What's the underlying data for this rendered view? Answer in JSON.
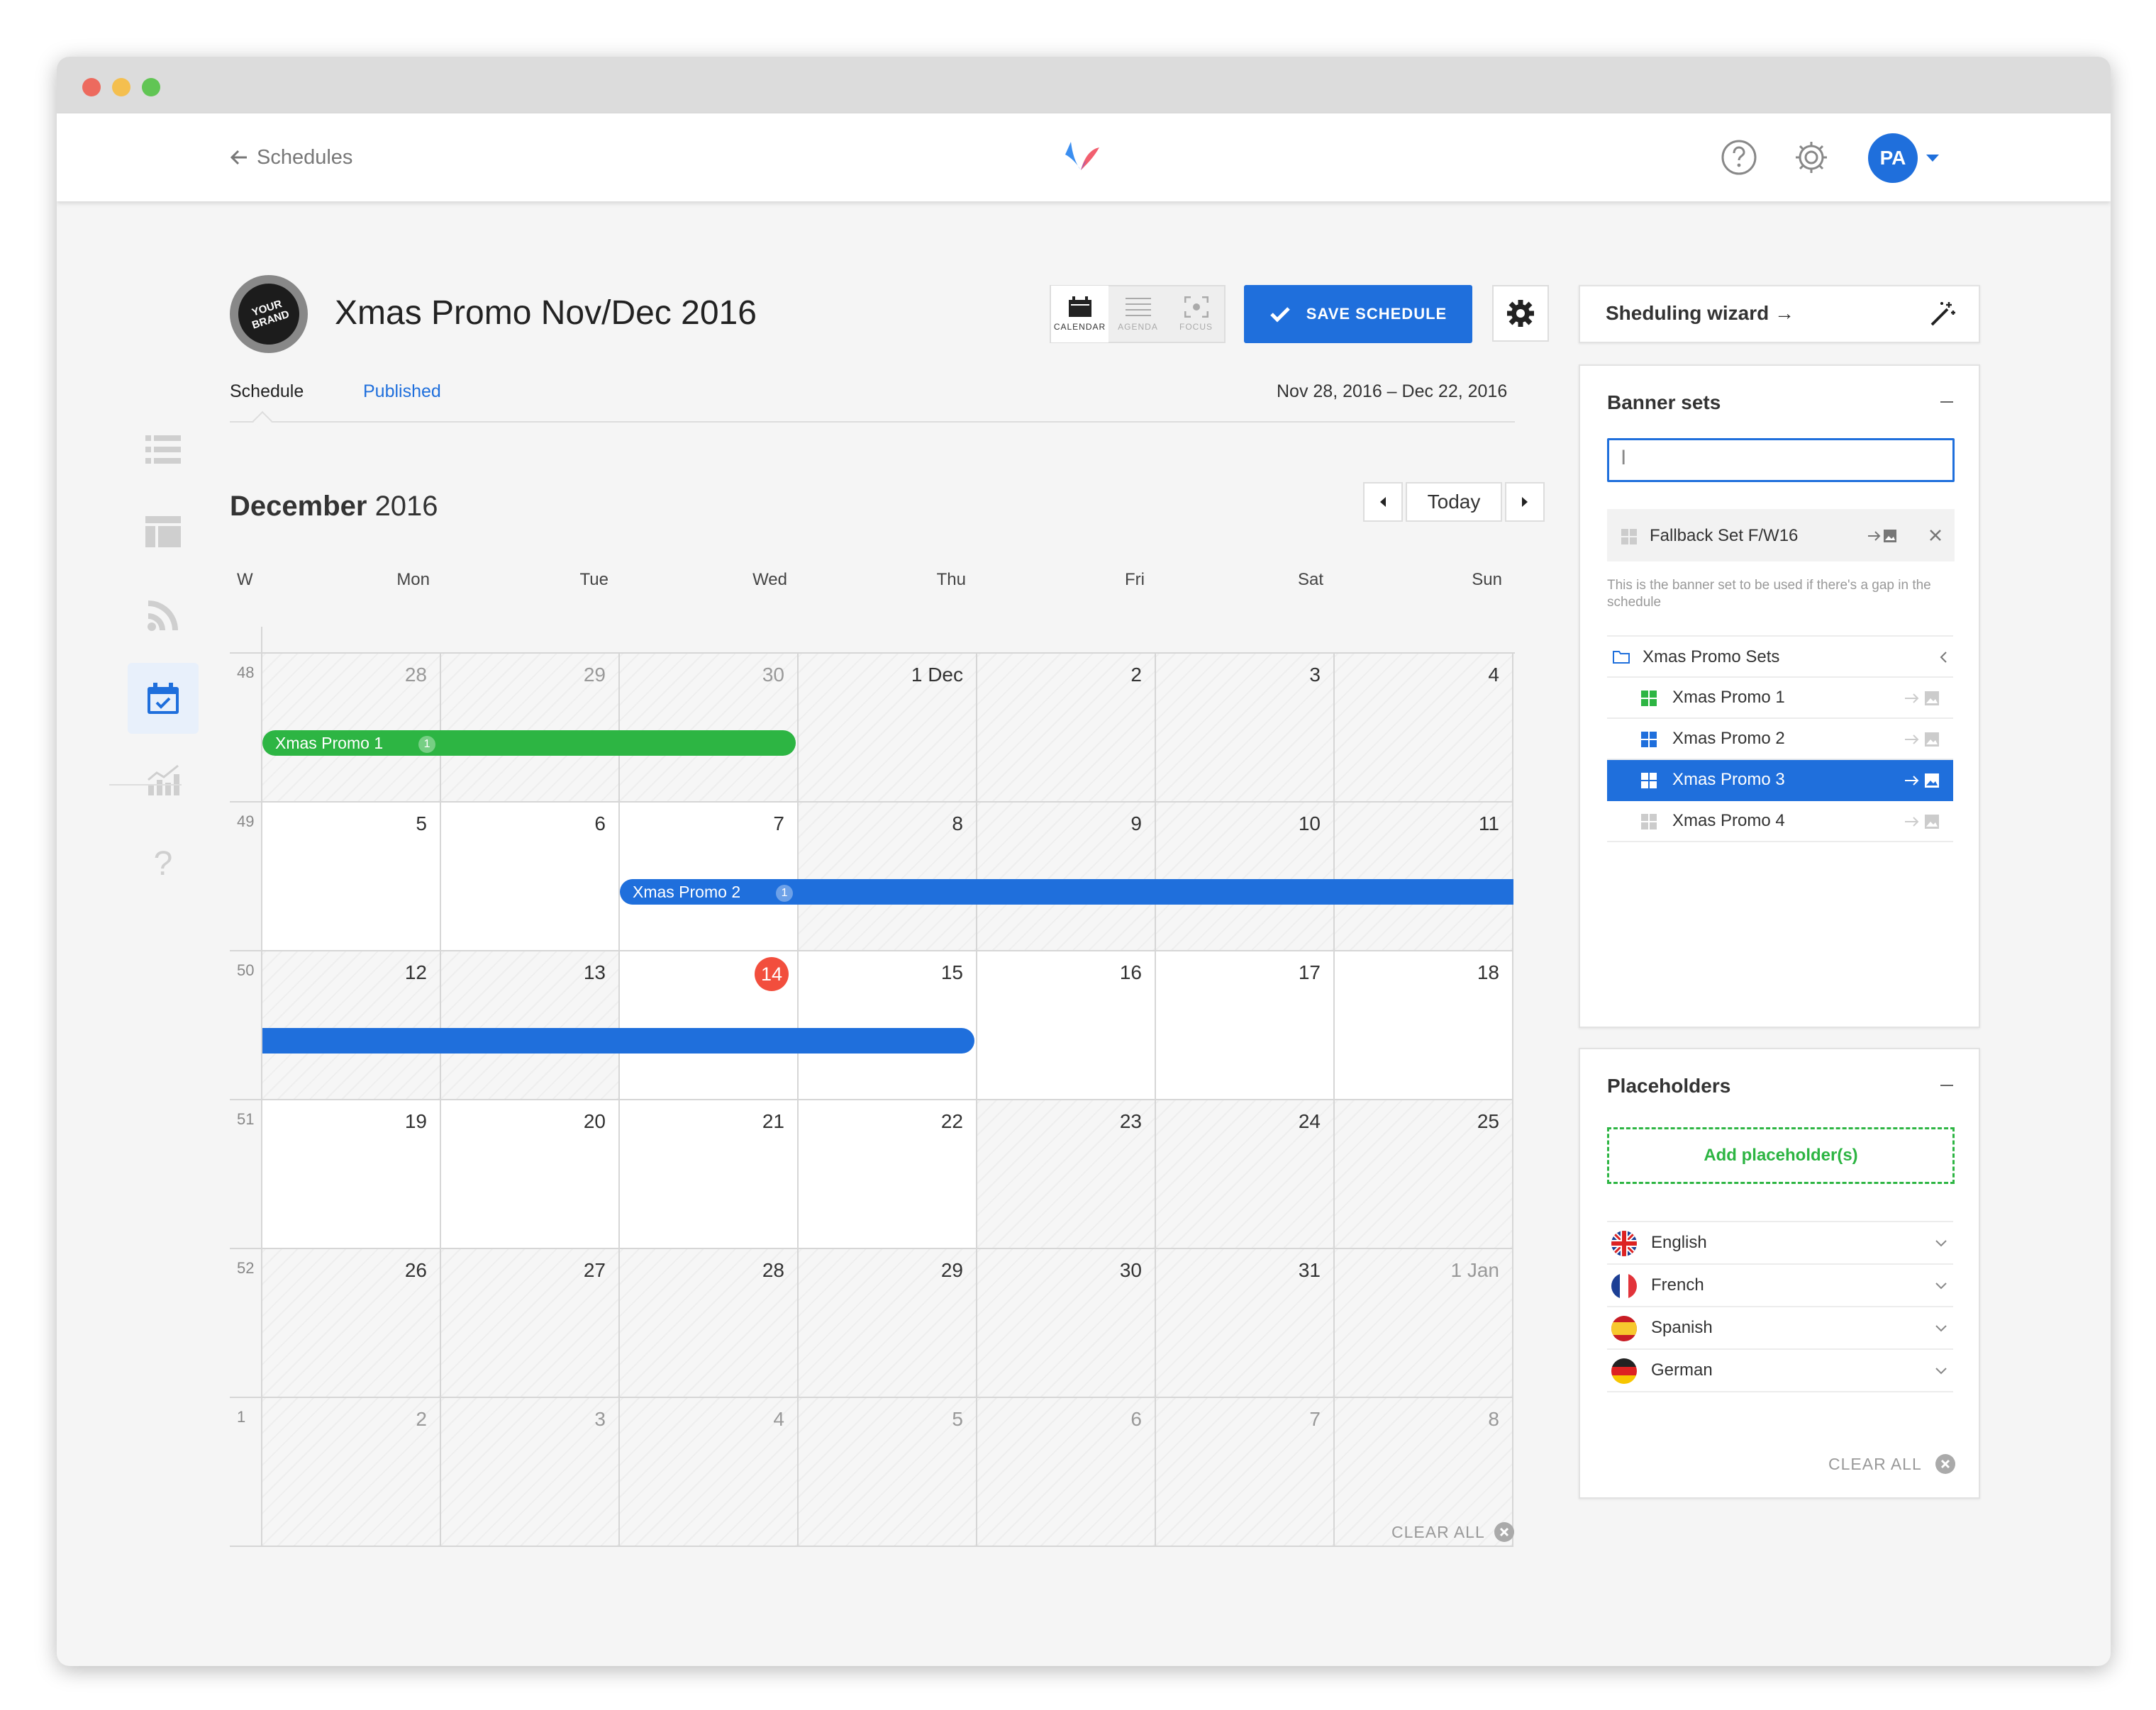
{
  "header": {
    "back_label": "Schedules",
    "avatar_initials": "PA"
  },
  "schedule": {
    "title": "Xmas Promo Nov/Dec 2016",
    "brand_logo_text": "YOUR BRAND",
    "tabs": [
      "Schedule",
      "Published"
    ],
    "date_range": "Nov 28, 2016 – Dec 22, 2016",
    "views": [
      "CALENDAR",
      "AGENDA",
      "FOCUS"
    ],
    "save_label": "SAVE SCHEDULE"
  },
  "calendar": {
    "month_label": "December",
    "year_label": "2016",
    "today_label": "Today",
    "week_col_label": "W",
    "days": [
      "Mon",
      "Tue",
      "Wed",
      "Thu",
      "Fri",
      "Sat",
      "Sun"
    ],
    "weeks": [
      {
        "num": "48",
        "dates": [
          "28",
          "29",
          "30",
          "1 Dec",
          "2",
          "3",
          "4"
        ]
      },
      {
        "num": "49",
        "dates": [
          "5",
          "6",
          "7",
          "8",
          "9",
          "10",
          "11"
        ]
      },
      {
        "num": "50",
        "dates": [
          "12",
          "13",
          "14",
          "15",
          "16",
          "17",
          "18"
        ]
      },
      {
        "num": "51",
        "dates": [
          "19",
          "20",
          "21",
          "22",
          "23",
          "24",
          "25"
        ]
      },
      {
        "num": "52",
        "dates": [
          "26",
          "27",
          "28",
          "29",
          "30",
          "31",
          "1 Jan"
        ]
      },
      {
        "num": "1",
        "dates": [
          "2",
          "3",
          "4",
          "5",
          "6",
          "7",
          "8"
        ]
      }
    ],
    "events": [
      {
        "label": "Xmas Promo 1",
        "count": "1",
        "color": "#2db543"
      },
      {
        "label": "Xmas Promo 2",
        "count": "1",
        "color": "#1f6fdc"
      }
    ],
    "clear_all_label": "CLEAR ALL"
  },
  "wizard": {
    "label": "Sheduling wizard →"
  },
  "banner_sets": {
    "title": "Banner sets",
    "search_value": "",
    "fallback_label": "Fallback Set F/W16",
    "fallback_note": "This is the banner set to be used if there's a gap in the schedule",
    "folder_label": "Xmas Promo Sets",
    "items": [
      {
        "label": "Xmas Promo 1",
        "color": "#2db543"
      },
      {
        "label": "Xmas Promo 2",
        "color": "#1f6fdc"
      },
      {
        "label": "Xmas Promo 3",
        "color": "#ffffff"
      },
      {
        "label": "Xmas Promo 4",
        "color": "#cccccc"
      }
    ]
  },
  "placeholders": {
    "title": "Placeholders",
    "add_label": "Add placeholder(s)",
    "languages": [
      "English",
      "French",
      "Spanish",
      "German"
    ],
    "clear_all_label": "CLEAR ALL"
  },
  "colors": {
    "accent": "#1f6fdc",
    "green": "#2db543",
    "today": "#f24e3d"
  }
}
